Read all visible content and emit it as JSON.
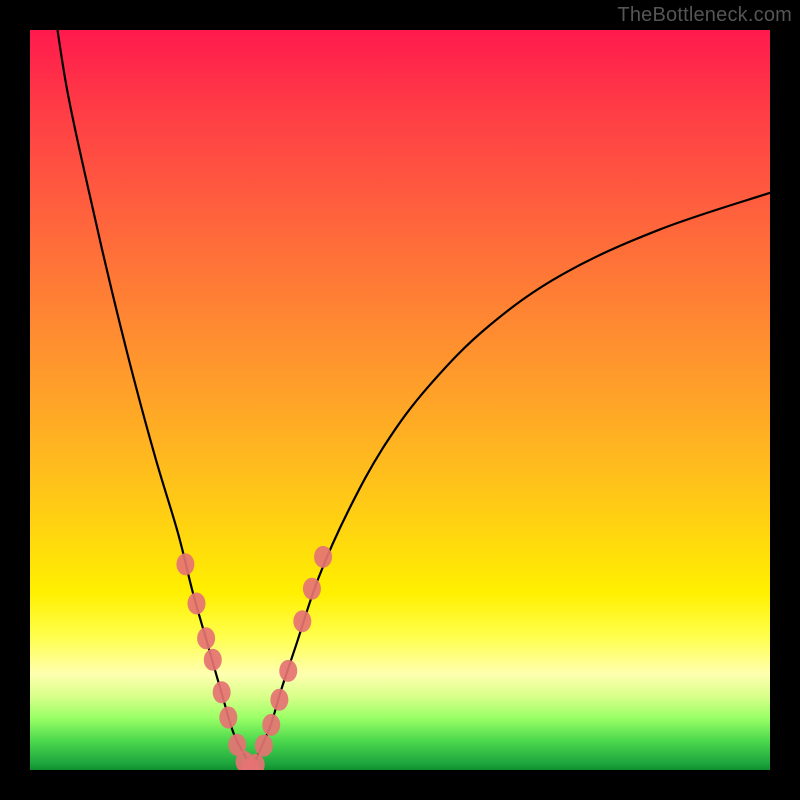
{
  "watermark": "TheBottleneck.com",
  "colors": {
    "curve": "#000000",
    "marker_fill": "#e57373",
    "marker_stroke": "#c94f4f"
  },
  "chart_data": {
    "type": "line",
    "title": "",
    "xlabel": "",
    "ylabel": "",
    "xlim": [
      0,
      100
    ],
    "ylim": [
      0,
      100
    ],
    "curve_left": {
      "x": [
        3,
        5,
        8,
        11,
        14,
        17,
        20,
        22,
        24,
        26,
        27.5,
        29,
        30
      ],
      "y": [
        105,
        92,
        78,
        65,
        53,
        42,
        32,
        24,
        17,
        10,
        5,
        2,
        0
      ]
    },
    "curve_right": {
      "x": [
        30,
        31,
        32.5,
        34,
        36,
        39,
        43,
        48,
        54,
        62,
        72,
        85,
        100
      ],
      "y": [
        0,
        2.5,
        6,
        11,
        17,
        26,
        35,
        44,
        52,
        60,
        67,
        73,
        78
      ]
    },
    "markers_left": {
      "x": [
        21.0,
        22.5,
        23.8,
        24.7,
        25.9,
        26.8,
        28.0,
        29.0,
        29.8
      ],
      "y": [
        27.8,
        22.5,
        17.8,
        14.9,
        10.5,
        7.1,
        3.4,
        1.1,
        0.2
      ]
    },
    "markers_right": {
      "x": [
        30.5,
        31.6,
        32.6,
        33.7,
        34.9,
        36.8,
        38.1,
        39.6
      ],
      "y": [
        0.7,
        3.3,
        6.1,
        9.5,
        13.4,
        20.1,
        24.5,
        28.8
      ]
    }
  }
}
